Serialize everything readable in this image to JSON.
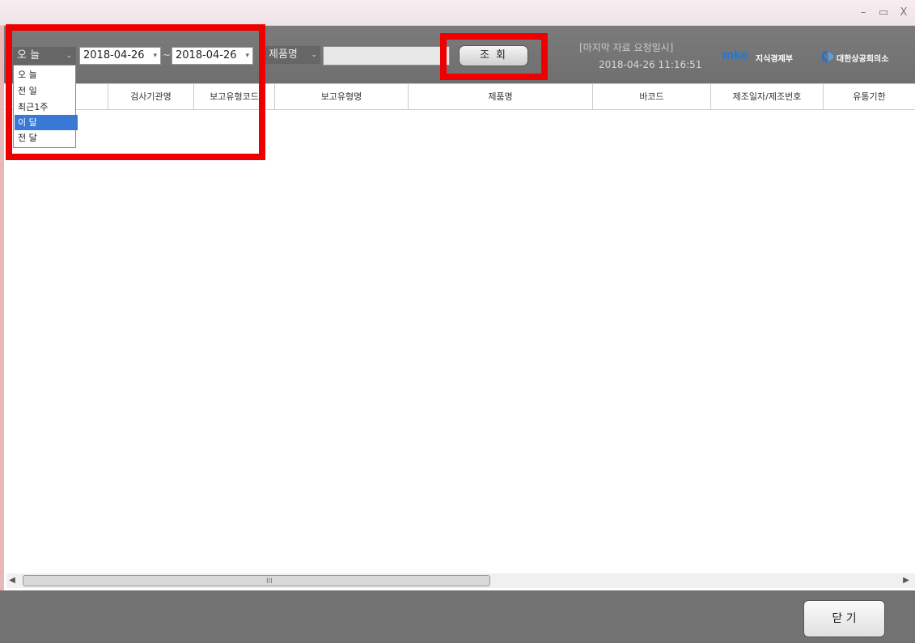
{
  "window": {
    "minimize": "–",
    "maximize": "▭",
    "close": "X"
  },
  "toolbar": {
    "period": "오    늘",
    "date_from": "2018-04-26",
    "tilde": "~",
    "date_to": "2018-04-26",
    "product_label": "제품명",
    "product_value": "",
    "search_button": "조 회",
    "last_request_label": "[마지막 자료 요청일시]",
    "last_request_time": "2018-04-26 11:16:51",
    "logo1_mark": "mke",
    "logo1_text": "지식경제부",
    "logo2_text": "대한상공회의소"
  },
  "period_options": [
    "오      늘",
    "전      일",
    "최근1주",
    "이      달",
    "전      달"
  ],
  "selected_period_index": 3,
  "table": {
    "headers": [
      "자",
      "검사기관명",
      "보고유형코드",
      "보고유형명",
      "제품명",
      "바코드",
      "제조일자/제조번호",
      "유통기한"
    ]
  },
  "scrollbar": {
    "left_arrow": "◀",
    "right_arrow": "▶",
    "grip": "III"
  },
  "footer": {
    "close_button": "닫 기"
  }
}
